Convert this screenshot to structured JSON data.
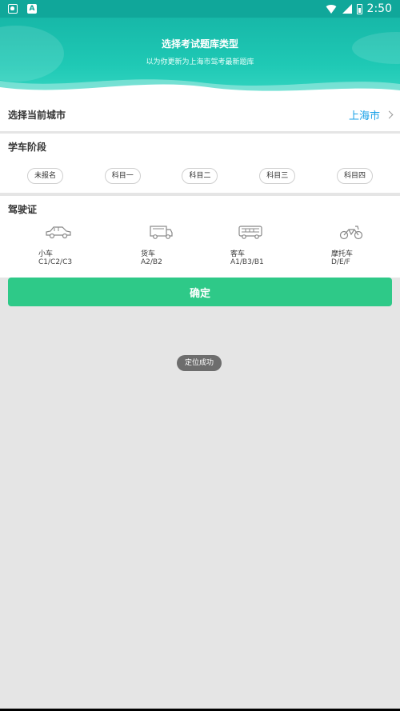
{
  "statusbar": {
    "time": "2:50",
    "left_icons": [
      "shield-icon",
      "app-a-icon"
    ]
  },
  "header": {
    "title": "选择考试题库类型",
    "subtitle": "以为你更新为上海市驾考最新题库",
    "color": "#17b8a8"
  },
  "city": {
    "label": "选择当前城市",
    "value": "上海市",
    "value_color": "#1aa2e8"
  },
  "stage": {
    "label": "学车阶段",
    "options": [
      "未报名",
      "科目一",
      "科目二",
      "科目三",
      "科目四"
    ]
  },
  "license": {
    "label": "驾驶证",
    "vehicles": [
      {
        "name": "小车",
        "code": "C1/C2/C3",
        "icon": "car-icon"
      },
      {
        "name": "货车",
        "code": "A2/B2",
        "icon": "truck-icon"
      },
      {
        "name": "客车",
        "code": "A1/B3/B1",
        "icon": "bus-icon"
      },
      {
        "name": "摩托车",
        "code": "D/E/F",
        "icon": "motorcycle-icon"
      }
    ]
  },
  "confirm": {
    "label": "确定",
    "color": "#2ec988"
  },
  "toast": {
    "text": "定位成功"
  }
}
